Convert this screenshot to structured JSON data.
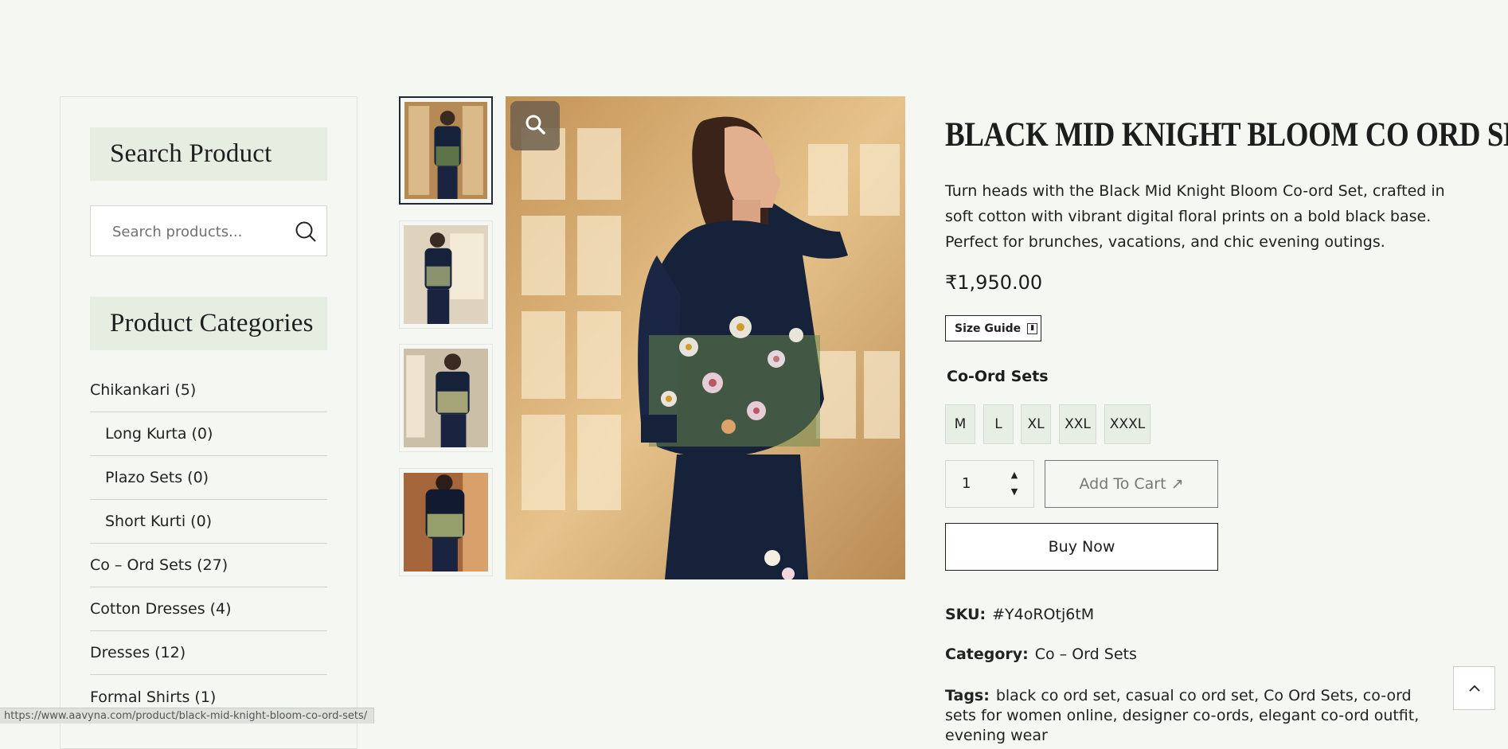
{
  "sidebar": {
    "search_title": "Search Product",
    "search_placeholder": "Search products...",
    "categories_title": "Product Categories",
    "categories": [
      {
        "label": "Chikankari (5)",
        "sub": false
      },
      {
        "label": "Long Kurta (0)",
        "sub": true
      },
      {
        "label": "Plazo Sets (0)",
        "sub": true
      },
      {
        "label": "Short Kurti (0)",
        "sub": true
      },
      {
        "label": "Co – Ord Sets (27)",
        "sub": false
      },
      {
        "label": "Cotton Dresses (4)",
        "sub": false
      },
      {
        "label": "Dresses (12)",
        "sub": false
      },
      {
        "label": "Formal Shirts (1)",
        "sub": false
      }
    ]
  },
  "gallery": {
    "zoom_icon": "search-icon",
    "thumbnails": [
      "thumbnail-1",
      "thumbnail-2",
      "thumbnail-3",
      "thumbnail-4"
    ]
  },
  "product": {
    "title": "BLACK MID KNIGHT BLOOM CO ORD SETS",
    "description": "Turn heads with the Black Mid Knight Bloom Co-ord Set, crafted in soft cotton with vibrant digital floral prints on a bold black base. Perfect for brunches, vacations, and chic evening outings.",
    "price": "₹1,950.00",
    "size_guide": "Size Guide",
    "variation_label": "Co-Ord Sets",
    "sizes": [
      "M",
      "L",
      "XL",
      "XXL",
      "XXXL"
    ],
    "quantity": "1",
    "add_to_cart": "Add To Cart ↗",
    "buy_now": "Buy Now",
    "sku_label": "SKU:",
    "sku": "#Y4oROtj6tM",
    "category_label": "Category:",
    "category": "Co – Ord Sets",
    "tags_label": "Tags:",
    "tags": "black co ord set, casual co ord set, Co Ord Sets, co-ord sets for women online, designer co-ords, elegant co-ord outfit, evening wear"
  },
  "status_url": "https://www.aavyna.com/product/black-mid-knight-bloom-co-ord-sets/",
  "colors": {
    "background": "#f4f7f2",
    "widget_title_bg": "#e6eee2",
    "size_option_bg": "#e7eee4",
    "text": "#1d1d1d"
  }
}
